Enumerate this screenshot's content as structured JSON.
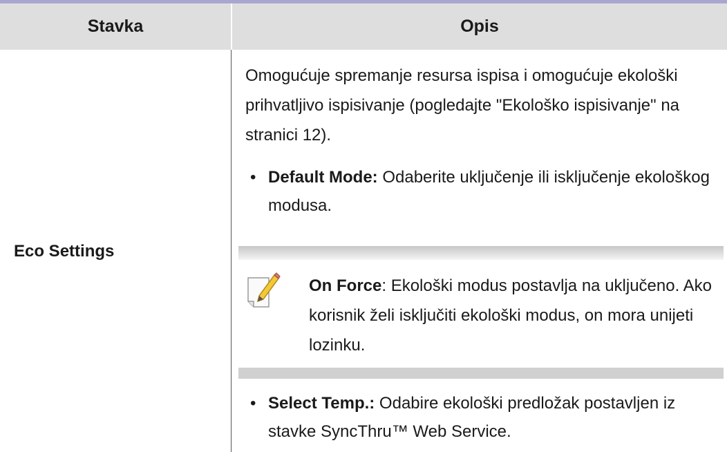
{
  "table": {
    "header_item": "Stavka",
    "header_desc": "Opis"
  },
  "row": {
    "item": "Eco Settings",
    "intro": "Omogućuje spremanje resursa ispisa i omogućuje ekološki prihvatljivo ispisivanje (pogledajte \"Ekološko ispisivanje\" na stranici 12).",
    "bullet1_label": "Default Mode:",
    "bullet1_text": " Odaberite uključenje ili isključenje ekološkog modusa.",
    "note_label": "On Force",
    "note_text": ": Ekološki modus postavlja na uključeno. Ako korisnik želi isključiti ekološki modus, on mora unijeti lozinku.",
    "note_icon": "note-pencil-icon",
    "bullet2_label": "Select Temp.:",
    "bullet2_text": " Odabire ekološki predložak postavljen iz stavke SyncThru™ Web Service."
  },
  "colors": {
    "top_rule": "#a9a7d0",
    "header_bg": "#dedede",
    "note_band": "#d0d0d0"
  }
}
